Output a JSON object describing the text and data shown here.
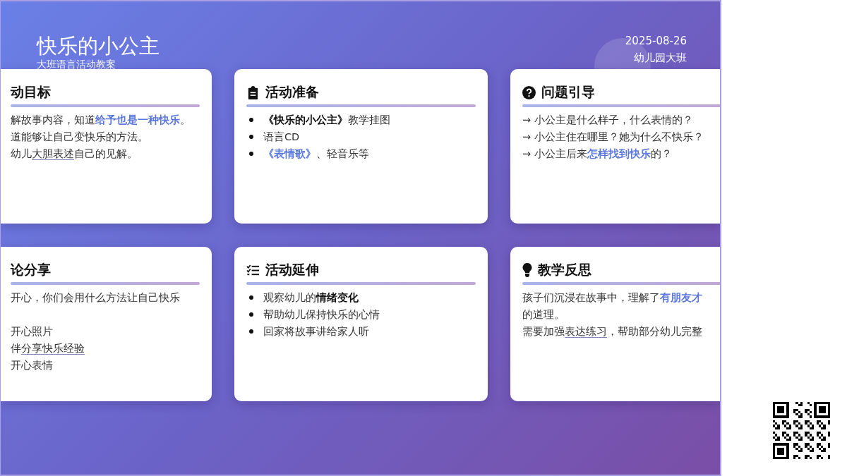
{
  "header": {
    "title": "快乐的小公主",
    "subtitle": "大班语言活动教案",
    "date": "2025-08-26",
    "class": "幼儿园大班"
  },
  "cards": [
    {
      "title": "动目标",
      "kind": "lines",
      "lines": [
        {
          "parts": [
            {
              "text": "解故事内容，知道",
              "kind": "plain"
            },
            {
              "text": "给予也是一种快乐",
              "kind": "accent"
            },
            {
              "text": "。",
              "kind": "plain"
            }
          ]
        },
        {
          "parts": [
            {
              "text": "道能够让自己变快乐的方法。",
              "kind": "plain"
            }
          ]
        },
        {
          "parts": [
            {
              "text": "幼儿",
              "kind": "plain"
            },
            {
              "text": "大胆表述",
              "kind": "underline"
            },
            {
              "text": "自己的见解。",
              "kind": "plain"
            }
          ]
        }
      ]
    },
    {
      "title": "活动准备",
      "kind": "bullets",
      "lines": [
        {
          "parts": [
            {
              "text": "《快乐的小公主》",
              "kind": "bold"
            },
            {
              "text": "教学挂图",
              "kind": "plain"
            }
          ]
        },
        {
          "parts": [
            {
              "text": "语言CD",
              "kind": "plain"
            }
          ]
        },
        {
          "parts": [
            {
              "text": "《表情歌》",
              "kind": "accent"
            },
            {
              "text": "、轻音乐等",
              "kind": "plain"
            }
          ]
        }
      ]
    },
    {
      "title": "问题引导",
      "kind": "lines",
      "lines": [
        {
          "parts": [
            {
              "text": "→ 小公主是什么样子，什么表情的？",
              "kind": "plain"
            }
          ]
        },
        {
          "parts": [
            {
              "text": "→ 小公主住在哪里？她为什么不快乐？",
              "kind": "plain"
            }
          ]
        },
        {
          "parts": [
            {
              "text": "→ 小公主后来",
              "kind": "plain"
            },
            {
              "text": "怎样找到快乐",
              "kind": "accent"
            },
            {
              "text": "的？",
              "kind": "plain"
            }
          ]
        }
      ]
    },
    {
      "title": "论分享",
      "kind": "lines",
      "lines": [
        {
          "parts": [
            {
              "text": "开心，你们会用什么方法让自己快乐",
              "kind": "plain"
            }
          ]
        },
        {
          "space_before": true,
          "parts": [
            {
              "text": "开心照片",
              "kind": "plain"
            }
          ]
        },
        {
          "parts": [
            {
              "text": "伴",
              "kind": "plain"
            },
            {
              "text": "分享快乐经验",
              "kind": "underline"
            }
          ]
        },
        {
          "parts": [
            {
              "text": "开心表情",
              "kind": "plain"
            }
          ]
        }
      ]
    },
    {
      "title": "活动延伸",
      "kind": "bullets",
      "lines": [
        {
          "parts": [
            {
              "text": "观察幼儿的",
              "kind": "plain"
            },
            {
              "text": "情绪变化",
              "kind": "bold"
            }
          ]
        },
        {
          "parts": [
            {
              "text": "帮助幼儿保持快乐的心情",
              "kind": "plain"
            }
          ]
        },
        {
          "parts": [
            {
              "text": "回家将故事讲给家人听",
              "kind": "plain"
            }
          ]
        }
      ]
    },
    {
      "title": "教学反思",
      "kind": "lines",
      "lines": [
        {
          "parts": [
            {
              "text": "孩子们沉浸在故事中，理解了",
              "kind": "plain"
            },
            {
              "text": "有朋友才",
              "kind": "accent"
            }
          ]
        },
        {
          "parts": [
            {
              "text": "的道理。",
              "kind": "plain"
            }
          ]
        },
        {
          "parts": [
            {
              "text": "需要加强",
              "kind": "plain"
            },
            {
              "text": "表达练习",
              "kind": "underline"
            },
            {
              "text": "，帮助部分幼儿完整",
              "kind": "plain"
            }
          ]
        }
      ]
    }
  ]
}
